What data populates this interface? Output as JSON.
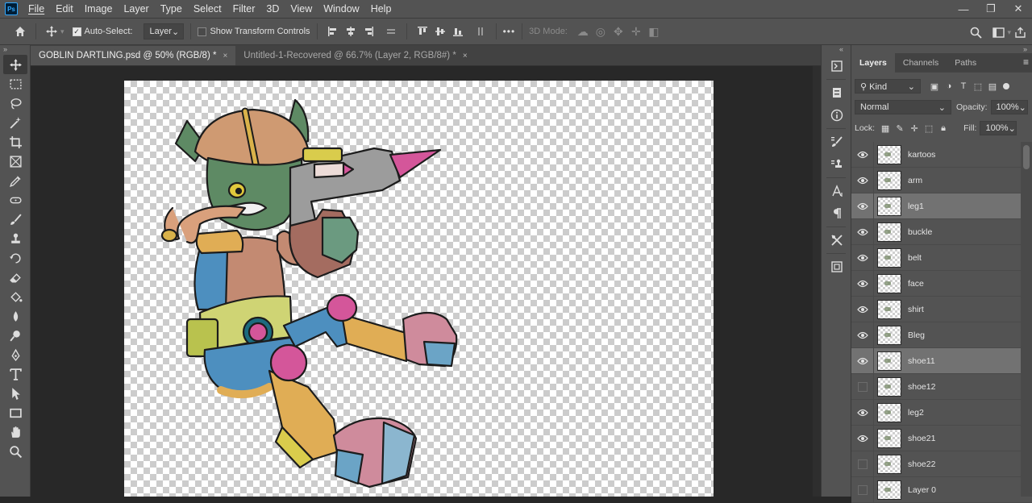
{
  "app": {
    "logo_text": "Ps"
  },
  "menu": [
    "File",
    "Edit",
    "Image",
    "Layer",
    "Type",
    "Select",
    "Filter",
    "3D",
    "View",
    "Window",
    "Help"
  ],
  "window_controls": {
    "minimize": "—",
    "restore": "❐",
    "close": "✕"
  },
  "options": {
    "auto_select_label": "Auto-Select:",
    "auto_select_checked": true,
    "auto_select_target": "Layer",
    "show_transform_label": "Show Transform Controls",
    "mode_3d_label": "3D Mode:",
    "more": "•••"
  },
  "tabs": [
    {
      "label": "GOBLIN DARTLING.psd @ 50% (RGB/8) *",
      "close": "×",
      "active": true
    },
    {
      "label": "Untitled-1-Recovered @ 66.7% (Layer 2, RGB/8#) *",
      "close": "×",
      "active": false
    }
  ],
  "layers_panel": {
    "tabs": [
      "Layers",
      "Channels",
      "Paths"
    ],
    "filter_kind": "Kind",
    "blend_mode": "Normal",
    "opacity_label": "Opacity:",
    "opacity_value": "100%",
    "lock_label": "Lock:",
    "fill_label": "Fill:",
    "fill_value": "100%",
    "layers": [
      {
        "name": "kartoos",
        "visible": true,
        "selected": false
      },
      {
        "name": "arm",
        "visible": true,
        "selected": false
      },
      {
        "name": "leg1",
        "visible": true,
        "selected": true
      },
      {
        "name": "buckle",
        "visible": true,
        "selected": false
      },
      {
        "name": "belt",
        "visible": true,
        "selected": false
      },
      {
        "name": "face",
        "visible": true,
        "selected": false
      },
      {
        "name": "shirt",
        "visible": true,
        "selected": false
      },
      {
        "name": "Bleg",
        "visible": true,
        "selected": false
      },
      {
        "name": "shoe11",
        "visible": true,
        "selected": true
      },
      {
        "name": "shoe12",
        "visible": false,
        "selected": false
      },
      {
        "name": "leg2",
        "visible": true,
        "selected": false
      },
      {
        "name": "shoe21",
        "visible": true,
        "selected": false
      },
      {
        "name": "shoe22",
        "visible": false,
        "selected": false
      },
      {
        "name": "Layer 0",
        "visible": false,
        "selected": false
      }
    ]
  },
  "colors": {
    "ui_panel": "#535353",
    "ui_dark": "#282828",
    "selected_layer": "#727272"
  }
}
